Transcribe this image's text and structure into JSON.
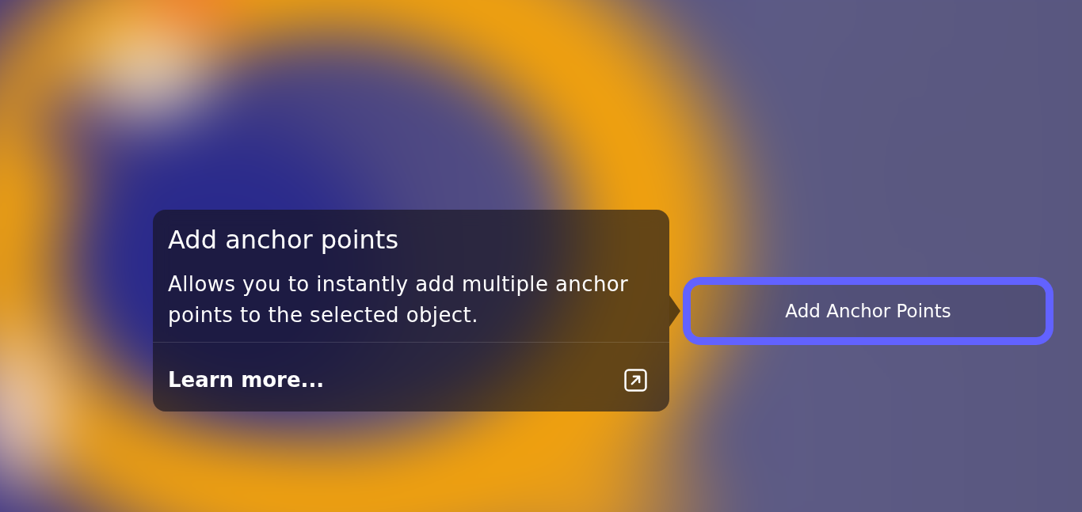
{
  "popover": {
    "title": "Add anchor points",
    "description": "Allows you to instantly add multiple anchor points to the selected object.",
    "link": {
      "label": "Learn more..."
    }
  },
  "button": {
    "label": "Add Anchor Points",
    "focused": true
  }
}
